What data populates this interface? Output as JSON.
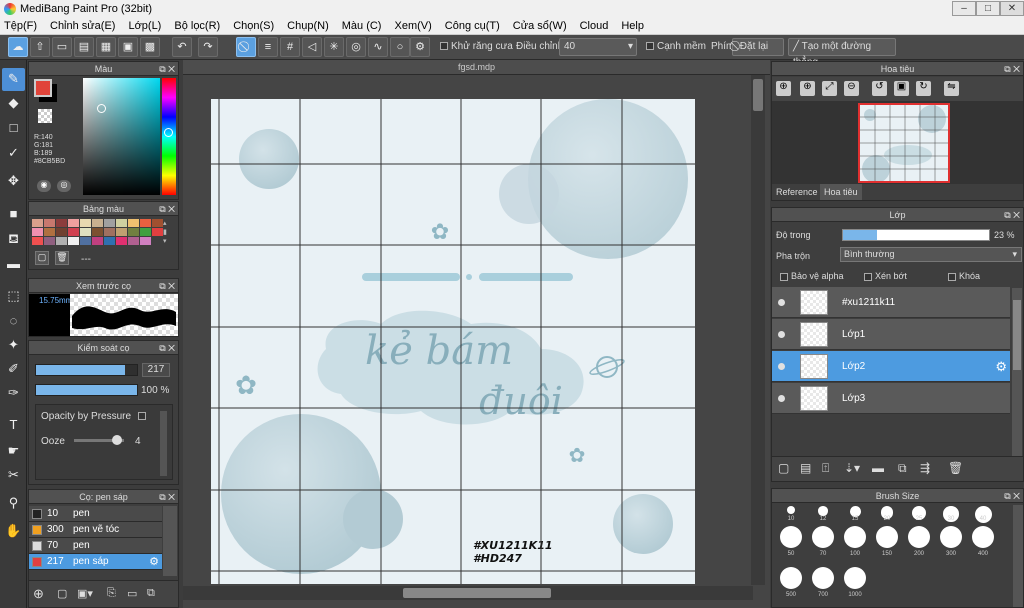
{
  "window": {
    "title": "MediBang Paint Pro (32bit)",
    "min": "–",
    "max": "□",
    "close": "✕"
  },
  "menu": [
    "Tệp(F)",
    "Chỉnh sửa(E)",
    "Lớp(L)",
    "Bộ lọc(R)",
    "Chọn(S)",
    "Chụp(N)",
    "Màu (C)",
    "Xem(V)",
    "Công cụ(T)",
    "Cửa sổ(W)",
    "Cloud",
    "Help"
  ],
  "toolbar": {
    "antialias_label": "Khử răng cưa",
    "correction_label": "Điều chỉnh",
    "correction_value": "40",
    "soft_edge_label": "Cạnh mềm",
    "key_label": "Phím",
    "reset_label": "Đặt lại",
    "line_label": "Tạo một đường thẳng"
  },
  "color_panel": {
    "title": "Màu",
    "r": "R:140",
    "g": "G:181",
    "b": "B:189",
    "hex": "#8CB5BD",
    "primary_color": "#e0443a",
    "secondary_color": "#000000"
  },
  "palette_panel": {
    "title": "Bảng màu",
    "dash": "---",
    "colors": [
      "#d9a08c",
      "#c8786e",
      "#8c3c3c",
      "#f0a0a0",
      "#e8d8b0",
      "#c8b090",
      "#a0a0a0",
      "#d0d0a0",
      "#f0c070",
      "#e86040",
      "#a05030",
      "#f090b0",
      "#b07040",
      "#704030",
      "#d04050",
      "#e0e0c0",
      "#7c5030",
      "#a07060",
      "#c0a070",
      "#708040",
      "#40a040",
      "#e04040",
      "#f05050",
      "#906080",
      "#b0b0b0",
      "#f0f0f0",
      "#5070a0",
      "#c04080",
      "#3070b0",
      "#e03070",
      "#b06090",
      "#d080c0"
    ]
  },
  "brush_preview": {
    "title": "Xem trước cọ",
    "size": "15.75mm"
  },
  "brush_control": {
    "title": "Kiểm soát cọ",
    "size_value": "217",
    "opacity_value": "100",
    "opacity_unit": "%",
    "size_fraction": 0.88,
    "opacity_fraction": 1.0,
    "pressure_label": "Opacity by Pressure",
    "ooze_label": "Ooze",
    "ooze_value": "4",
    "ooze_fraction": 0.85
  },
  "brush_list": {
    "title": "Cọ: pen sáp",
    "items": [
      {
        "size": "10",
        "name": "pen",
        "color": "#222222"
      },
      {
        "size": "300",
        "name": "pen vẽ tóc",
        "color": "#f0a020"
      },
      {
        "size": "70",
        "name": "pen",
        "color": "#dddddd"
      },
      {
        "size": "217",
        "name": "pen sáp",
        "color": "#e04040"
      }
    ]
  },
  "document": {
    "tab": "fgsd.mdp",
    "text_line1": "kẻ bám",
    "text_line2": "đuôi",
    "tag1": "#XU1211K11",
    "tag2": "#HD247"
  },
  "navigator": {
    "title": "Hoa tiêu",
    "tab_reference": "Reference",
    "tab_navigator": "Hoa tiêu"
  },
  "layer_panel": {
    "title": "Lớp",
    "opacity_label": "Độ trong",
    "opacity_value": "23",
    "opacity_unit": "%",
    "opacity_fraction": 0.23,
    "blend_label": "Pha trộn",
    "blend_value": "Bình thường",
    "protect_alpha": "Bảo vệ alpha",
    "clipping": "Xén bớt",
    "lock": "Khóa",
    "layers": [
      {
        "name": "#xu1211k11",
        "selected": false
      },
      {
        "name": "Lớp1",
        "selected": false
      },
      {
        "name": "Lớp2",
        "selected": true
      },
      {
        "name": "Lớp3",
        "selected": false
      }
    ]
  },
  "brush_size": {
    "title": "Brush Size",
    "row0": [
      "10",
      "12",
      "15",
      "20",
      "25",
      "30",
      "40"
    ],
    "row1": [
      "50",
      "70",
      "100",
      "150",
      "200",
      "300",
      "400"
    ],
    "row2": [
      "500",
      "700",
      "1000"
    ]
  }
}
